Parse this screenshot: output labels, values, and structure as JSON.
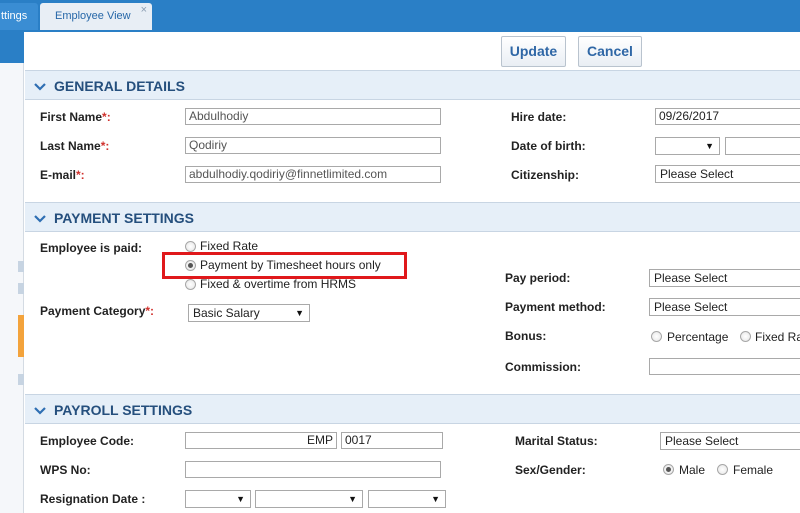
{
  "tabs": {
    "settings_tab_label": "ttings",
    "employee_view_label": "Employee View",
    "close_glyph": "×"
  },
  "toolbar": {
    "update_label": "Update",
    "cancel_label": "Cancel"
  },
  "general": {
    "section_title": "GENERAL DETAILS",
    "first_name_label": "First Name",
    "first_name_value": "Abdulhodiy",
    "last_name_label": "Last Name",
    "last_name_value": "Qodiriy",
    "email_label": "E-mail",
    "email_value": "abdulhodiy.qodiriy@finnetlimited.com",
    "hire_date_label": "Hire date:",
    "hire_date_value": "09/26/2017",
    "dob_label": "Date of birth:",
    "citizenship_label": "Citizenship:",
    "citizenship_value": "Please Select"
  },
  "payment": {
    "section_title": "PAYMENT SETTINGS",
    "employee_paid_label": "Employee is paid:",
    "options": [
      {
        "label": "Fixed Rate",
        "selected": false
      },
      {
        "label": "Payment by Timesheet hours only",
        "selected": true
      },
      {
        "label": "Fixed & overtime from HRMS",
        "selected": false
      }
    ],
    "category_label": "Payment Category",
    "category_value": "Basic Salary",
    "pay_period_label": "Pay period:",
    "pay_period_value": "Please Select",
    "method_label": "Payment method:",
    "method_value": "Please Select",
    "bonus_label": "Bonus:",
    "bonus_percentage": "Percentage",
    "bonus_fixed": "Fixed Ra",
    "commission_label": "Commission:"
  },
  "payroll": {
    "section_title": "PAYROLL SETTINGS",
    "employee_code_label": "Employee Code:",
    "employee_code_prefix": "EMP",
    "employee_code_number": "0017",
    "wps_label": "WPS No:",
    "resignation_label": "Resignation Date :",
    "marital_label": "Marital Status:",
    "marital_value": "Please Select",
    "gender_label": "Sex/Gender:",
    "gender_male": "Male",
    "gender_female": "Female"
  },
  "required_marker": "*:",
  "required_marker_short": "*",
  "dropdown_arrow": "▼",
  "chevron_glyph": "❯",
  "colors": {
    "brand_blue": "#2a7fc6",
    "section_bg": "#e6eff8",
    "highlight_red": "#e0181b",
    "accent_orange": "#f3a33c"
  }
}
